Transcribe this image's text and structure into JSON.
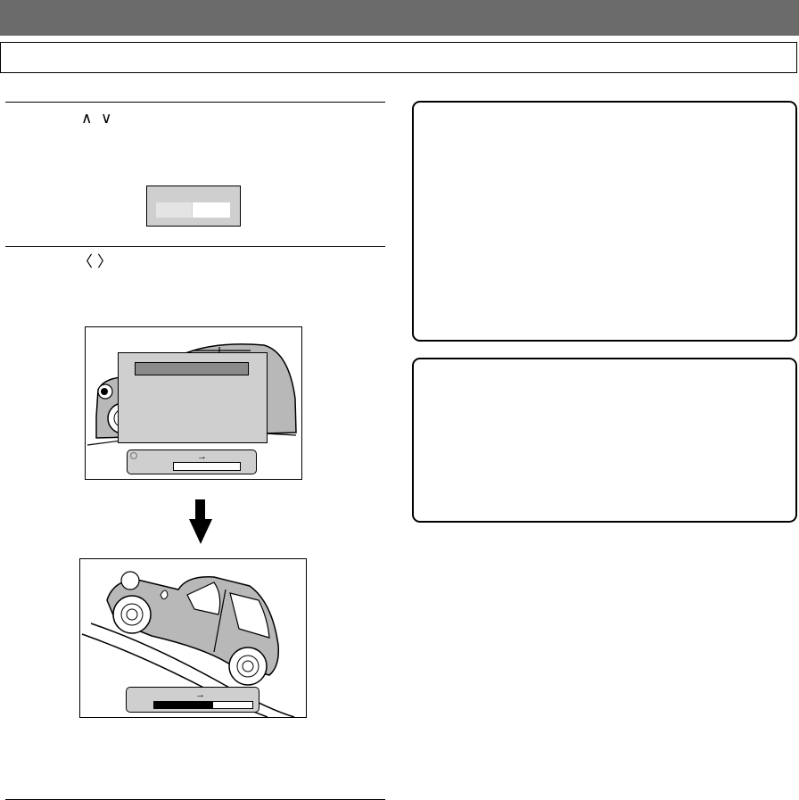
{
  "page": {
    "header_bar_color": "#6b6b6b",
    "title": ""
  },
  "step1": {
    "keys": [
      "∧",
      "∨"
    ],
    "selector_options": [
      "",
      ""
    ]
  },
  "step2": {
    "keys": [
      "〈",
      "〉"
    ]
  },
  "screen1": {
    "menu_selected": "",
    "status_arrow": "→",
    "progress_fraction": 0.0
  },
  "transition_arrow": "down-arrow",
  "screen2": {
    "status_arrow": "→",
    "progress_fraction": 0.6
  },
  "colors": {
    "panel_gray": "#cfcfcf",
    "car_gray": "#b8b8b8",
    "selected_bar": "#8a8a8a",
    "ink": "#000000"
  }
}
